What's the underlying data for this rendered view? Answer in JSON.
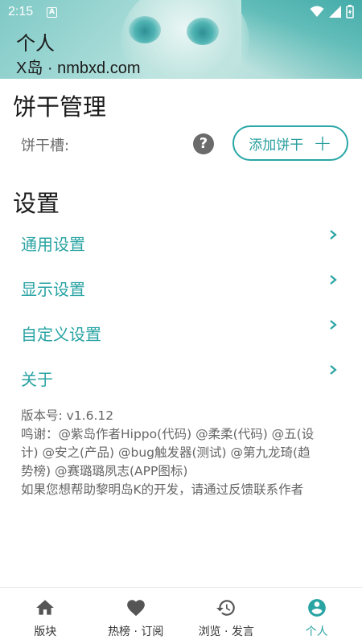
{
  "status": {
    "time": "2:15",
    "notif_letter": "A"
  },
  "header": {
    "title": "个人",
    "subtitle": "X岛 · nmbxd.com"
  },
  "cookie": {
    "section_title": "饼干管理",
    "slot_label": "饼干槽:",
    "add_button_label": "添加饼干"
  },
  "settings": {
    "section_title": "设置",
    "items": [
      {
        "label": "通用设置"
      },
      {
        "label": "显示设置"
      },
      {
        "label": "自定义设置"
      },
      {
        "label": "关于"
      }
    ]
  },
  "info": {
    "version": "版本号: v1.6.12",
    "thanks_lines": [
      "鸣谢：@紫岛作者Hippo(代码) @柔柔(代码) @五(设",
      "计) @安之(产品) @bug触发器(测试) @第九龙琦(趋",
      "势榜) @赛璐璐夙志(APP图标)"
    ],
    "contribute": "如果您想帮助黎明岛K的开发，请通过反馈联系作者"
  },
  "nav": {
    "items": [
      {
        "label": "版块",
        "icon": "home-icon"
      },
      {
        "label": "热榜 · 订阅",
        "icon": "heart-icon"
      },
      {
        "label": "浏览 · 发言",
        "icon": "history-icon"
      },
      {
        "label": "个人",
        "icon": "account-circle-icon"
      }
    ],
    "active_index": 3
  },
  "colors": {
    "accent": "#2aa3a3",
    "header_bg": "#9fd3cf"
  }
}
